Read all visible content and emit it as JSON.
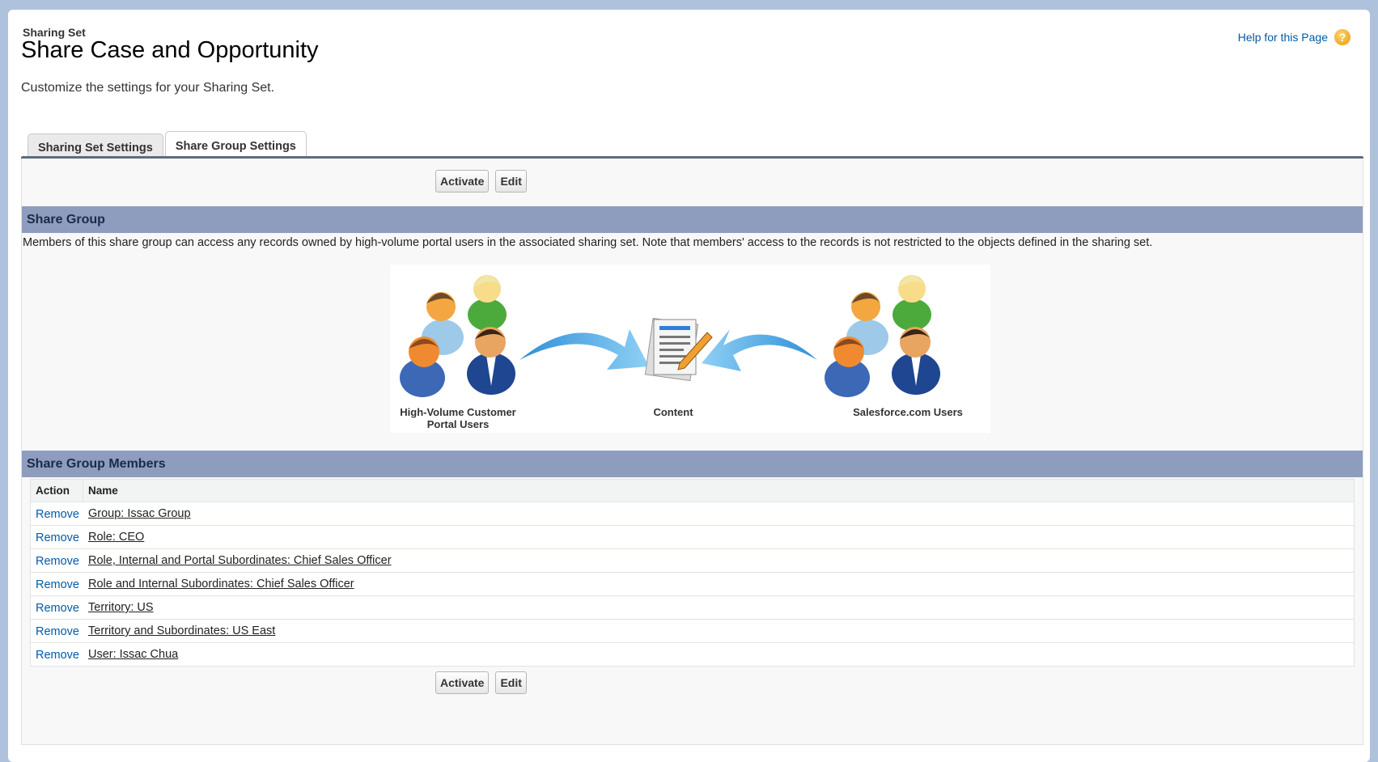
{
  "header": {
    "subtitle": "Sharing Set",
    "title": "Share Case and Opportunity",
    "description": "Customize the settings for your Sharing Set.",
    "help_label": "Help for this Page",
    "help_icon": "question-circle-icon"
  },
  "tabs": [
    {
      "label": "Sharing Set Settings",
      "active": false
    },
    {
      "label": "Share Group Settings",
      "active": true
    }
  ],
  "buttons": {
    "activate": "Activate",
    "edit": "Edit"
  },
  "share_group": {
    "heading": "Share Group",
    "description": "Members of this share group can access any records owned by high-volume portal users in the associated sharing set. Note that members' access to the records is not restricted to the objects defined in the sharing set.",
    "diagram": {
      "left_label_line1": "High-Volume Customer",
      "left_label_line2": "Portal Users",
      "center_label": "Content",
      "right_label": "Salesforce.com Users"
    }
  },
  "members": {
    "heading": "Share Group Members",
    "columns": {
      "action": "Action",
      "name": "Name"
    },
    "rows": [
      {
        "action": "Remove",
        "name": "Group: Issac Group"
      },
      {
        "action": "Remove",
        "name": "Role: CEO"
      },
      {
        "action": "Remove",
        "name": "Role, Internal and Portal Subordinates: Chief Sales Officer"
      },
      {
        "action": "Remove",
        "name": "Role and Internal Subordinates: Chief Sales Officer"
      },
      {
        "action": "Remove",
        "name": "Territory: US"
      },
      {
        "action": "Remove",
        "name": "Territory and Subordinates: US East"
      },
      {
        "action": "Remove",
        "name": "User: Issac Chua"
      }
    ]
  },
  "colors": {
    "section_header": "#8e9dbe",
    "link": "#015ba7",
    "page_background": "#aec2dd"
  }
}
